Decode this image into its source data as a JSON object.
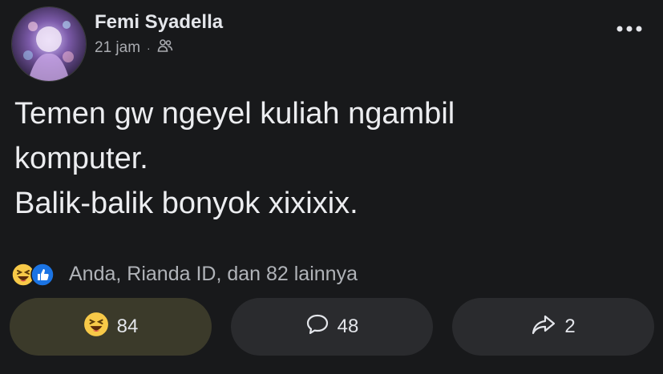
{
  "post": {
    "author": "Femi Syadella",
    "time": "21 jam",
    "separator": "·",
    "audience_icon": "friends-icon",
    "text_lines": [
      "Temen gw ngeyel kuliah ngambil",
      "komputer.",
      "Balik-balik bonyok xixixix."
    ]
  },
  "reactions": {
    "icons": [
      "haha-emoji-icon",
      "like-icon"
    ],
    "summary": "Anda, Rianda ID, dan 82 lainnya"
  },
  "actions": {
    "react": {
      "icon": "haha-emoji-icon",
      "count": "84"
    },
    "comment": {
      "icon": "comment-bubble-icon",
      "count": "48"
    },
    "share": {
      "icon": "share-arrow-icon",
      "count": "2"
    }
  },
  "colors": {
    "background": "#18191b",
    "button": "#2a2b2e",
    "button_active": "#3b3a2a",
    "haha_yellow": "#f7c948",
    "like_blue": "#1b74e4"
  }
}
